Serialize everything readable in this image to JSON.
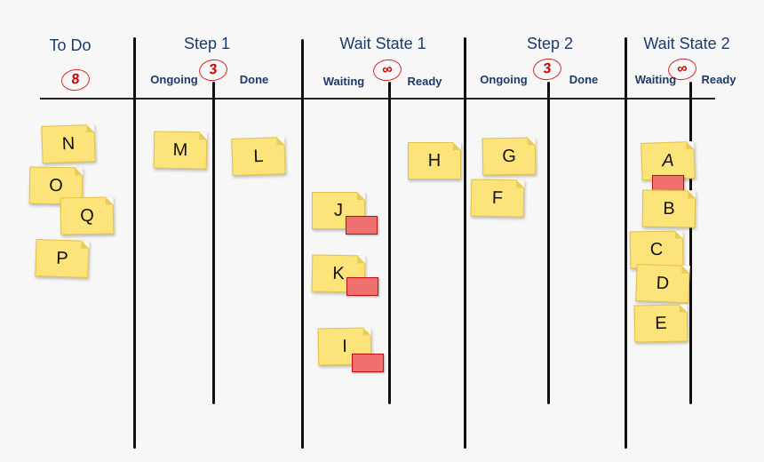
{
  "columns": [
    {
      "title": "To Do",
      "limit": "8"
    },
    {
      "title": "Step 1",
      "limit": "3",
      "sub": [
        "Ongoing",
        "Done"
      ]
    },
    {
      "title": "Wait State 1",
      "limit": "∞",
      "sub": [
        "Waiting",
        "Ready"
      ]
    },
    {
      "title": "Step 2",
      "limit": "3",
      "sub": [
        "Ongoing",
        "Done"
      ]
    },
    {
      "title": "Wait State 2",
      "limit": "∞",
      "sub": [
        "Waiting",
        "Ready"
      ]
    }
  ],
  "cards": [
    {
      "label": "N",
      "lane": "To Do",
      "blocked": false
    },
    {
      "label": "O",
      "lane": "To Do",
      "blocked": false
    },
    {
      "label": "Q",
      "lane": "To Do",
      "blocked": false
    },
    {
      "label": "P",
      "lane": "To Do",
      "blocked": false
    },
    {
      "label": "M",
      "lane": "Step 1 Ongoing",
      "blocked": false
    },
    {
      "label": "L",
      "lane": "Step 1 Done",
      "blocked": false
    },
    {
      "label": "J",
      "lane": "Wait State 1 Waiting",
      "blocked": true
    },
    {
      "label": "K",
      "lane": "Wait State 1 Waiting",
      "blocked": true
    },
    {
      "label": "I",
      "lane": "Wait State 1 Waiting",
      "blocked": true
    },
    {
      "label": "H",
      "lane": "Wait State 1 Ready",
      "blocked": false
    },
    {
      "label": "G",
      "lane": "Step 2 Ongoing",
      "blocked": false
    },
    {
      "label": "F",
      "lane": "Step 2 Ongoing",
      "blocked": false
    },
    {
      "label": "A",
      "lane": "Wait State 2 Waiting",
      "blocked": true
    },
    {
      "label": "B",
      "lane": "Wait State 2 Waiting",
      "blocked": false
    },
    {
      "label": "C",
      "lane": "Wait State 2 Waiting",
      "blocked": false
    },
    {
      "label": "D",
      "lane": "Wait State 2 Waiting",
      "blocked": false
    },
    {
      "label": "E",
      "lane": "Wait State 2 Waiting",
      "blocked": false
    }
  ],
  "colors": {
    "note": "#fde47a",
    "blocker": "#f07070",
    "header": "#1c3a6e",
    "limit": "#c00000"
  }
}
